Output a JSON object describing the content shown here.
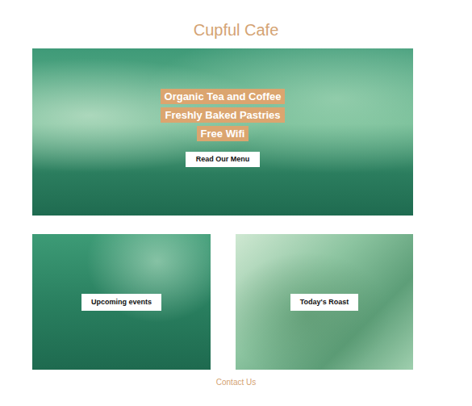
{
  "site": {
    "title": "Cupful Cafe"
  },
  "hero": {
    "lines": [
      "Organic Tea and Coffee",
      "Freshly Baked Pastries",
      "Free Wifi"
    ],
    "button": "Read Our Menu"
  },
  "cards": [
    {
      "label": "Upcoming events"
    },
    {
      "label": "Today's Roast"
    }
  ],
  "footer": {
    "link": "Contact Us"
  }
}
